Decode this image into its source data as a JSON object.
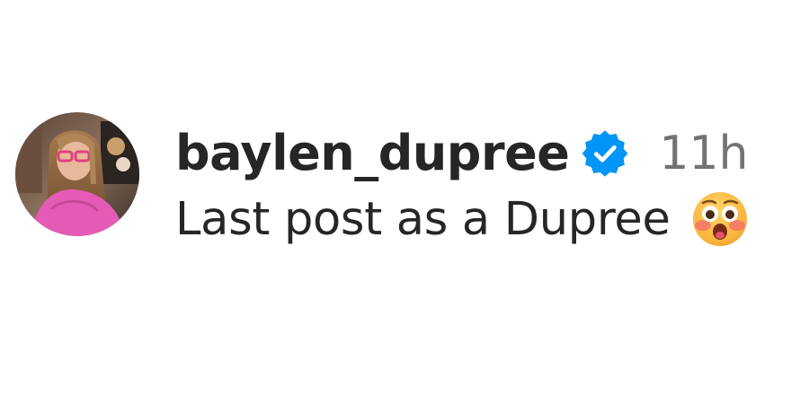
{
  "comment": {
    "username": "baylen_dupree",
    "verified_icon": "verified-badge-icon",
    "timestamp": "11h",
    "text": "Last post as a Dupree",
    "emoji": "flushed-face",
    "emoji_char": "😳"
  },
  "colors": {
    "username": "#262626",
    "timestamp": "#737373",
    "verified_badge": "#0095f6",
    "avatar_outfit": "#e45bb5"
  }
}
